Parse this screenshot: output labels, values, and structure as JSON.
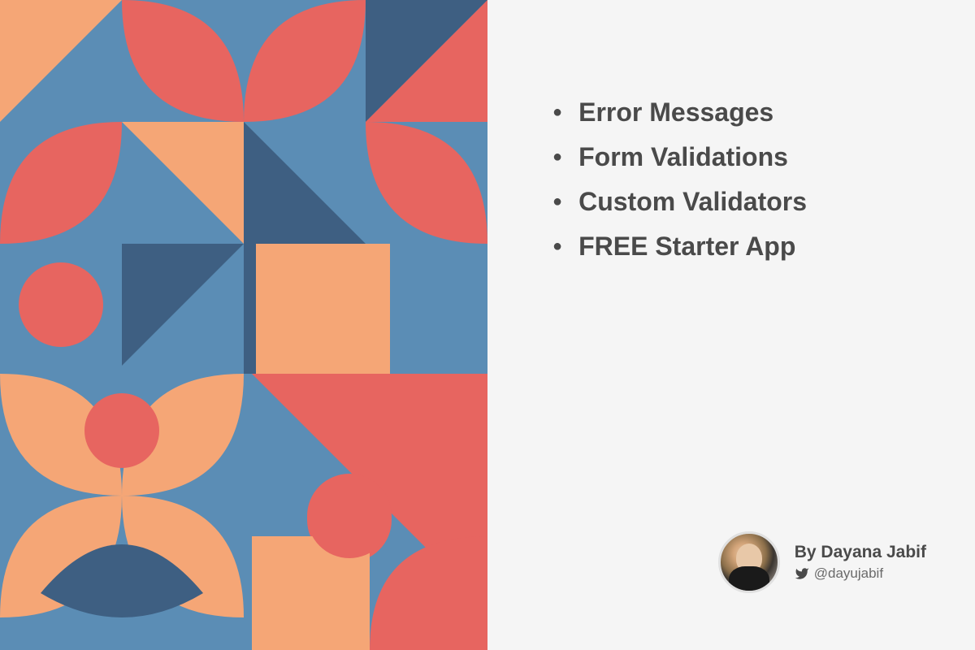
{
  "bullets": [
    "Error Messages",
    "Form Validations",
    "Custom Validators",
    "FREE Starter App"
  ],
  "author": {
    "byline": "By Dayana Jabif",
    "handle": "@dayujabif"
  },
  "colors": {
    "blue_mid": "#5b8db5",
    "blue_dark": "#3e5f82",
    "coral": "#e76560",
    "peach": "#f5a676"
  }
}
